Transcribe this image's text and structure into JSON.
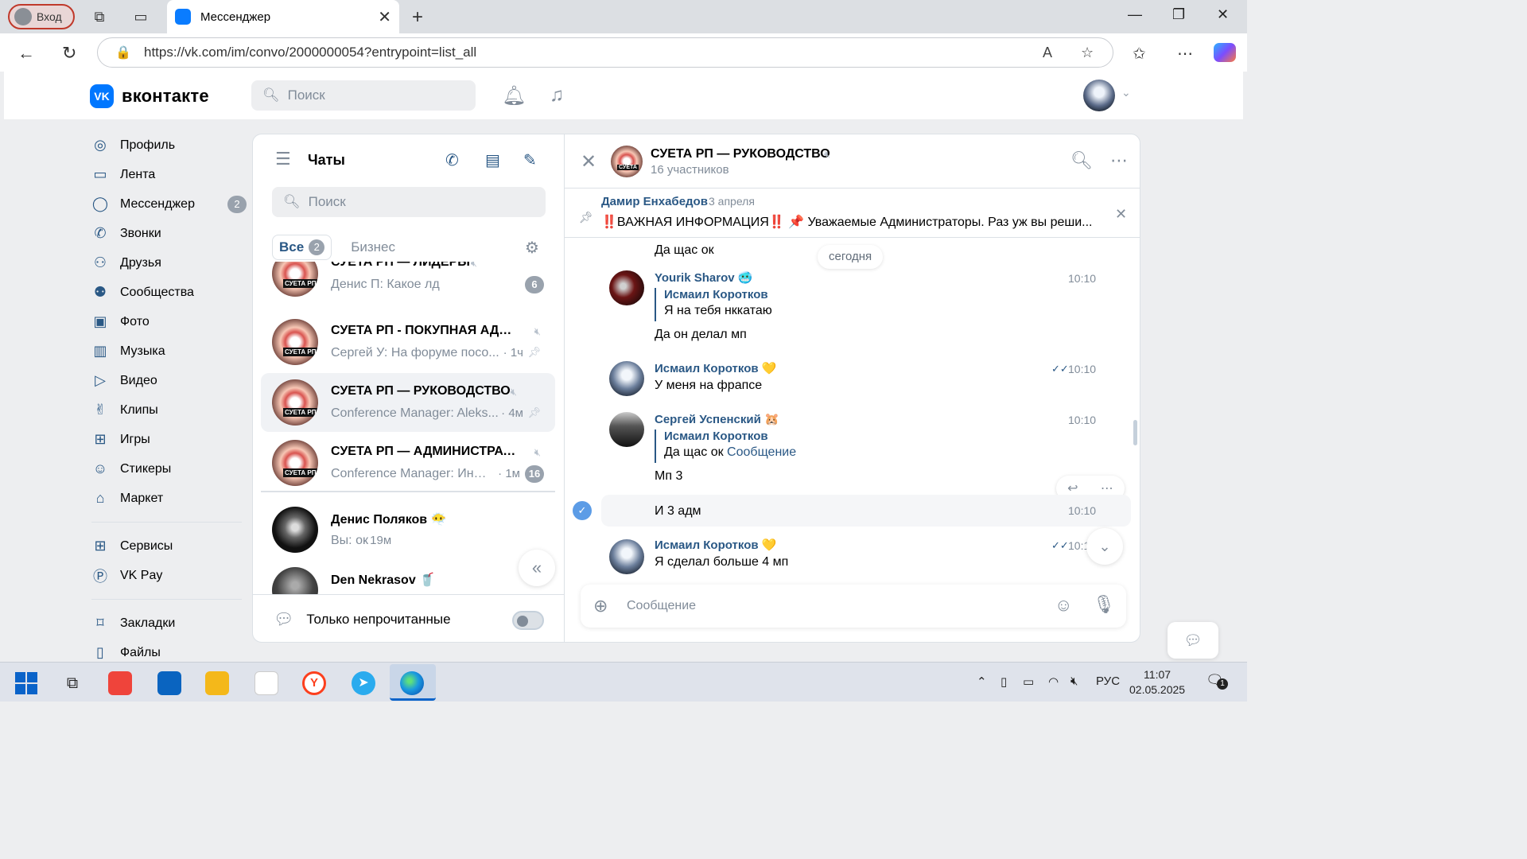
{
  "browser": {
    "profile_label": "Вход",
    "tab_title": "Мессенджер",
    "url": "https://vk.com/im/convo/2000000054?entrypoint=list_all"
  },
  "header": {
    "logo_text": "вконтакте",
    "search_placeholder": "Поиск"
  },
  "leftnav": {
    "items": [
      {
        "label": "Профиль",
        "icon": "profile-icon"
      },
      {
        "label": "Лента",
        "icon": "feed-icon"
      },
      {
        "label": "Мессенджер",
        "icon": "messenger-icon",
        "badge": "2"
      },
      {
        "label": "Звонки",
        "icon": "phone-icon"
      },
      {
        "label": "Друзья",
        "icon": "friends-icon"
      },
      {
        "label": "Сообщества",
        "icon": "communities-icon"
      },
      {
        "label": "Фото",
        "icon": "photo-icon"
      },
      {
        "label": "Музыка",
        "icon": "music-icon"
      },
      {
        "label": "Видео",
        "icon": "video-icon"
      },
      {
        "label": "Клипы",
        "icon": "clips-icon"
      },
      {
        "label": "Игры",
        "icon": "games-icon"
      },
      {
        "label": "Стикеры",
        "icon": "stickers-icon"
      },
      {
        "label": "Маркет",
        "icon": "market-icon"
      }
    ],
    "items2": [
      {
        "label": "Сервисы",
        "icon": "services-icon"
      },
      {
        "label": "VK Pay",
        "icon": "vkpay-icon"
      }
    ],
    "items3": [
      {
        "label": "Закладки",
        "icon": "bookmarks-icon"
      },
      {
        "label": "Файлы",
        "icon": "files-icon"
      }
    ]
  },
  "chatlist": {
    "title": "Чаты",
    "search_placeholder": "Поиск",
    "tab_all": "Все",
    "tab_all_count": "2",
    "tab_business": "Бизнес",
    "conversations": [
      {
        "name": "СУЕТА РП — ЛИДЕРЫ",
        "message": "Денис П: Какое лд",
        "time": "",
        "unread": "6",
        "muted": true,
        "pinned": false,
        "avatar_label": "СУЕТА РП"
      },
      {
        "name": "СУЕТА РП - ПОКУПНАЯ АДМИ...",
        "message": "Сергей У: На форуме посо...",
        "time": "· 1ч",
        "unread": "",
        "muted": true,
        "pinned": true,
        "avatar_label": "СУЕТА РП"
      },
      {
        "name": "СУЕТА РП — РУКОВОДСТВО",
        "message": "Conference Manager: Aleks...",
        "time": "· 4м",
        "unread": "",
        "muted": true,
        "pinned": true,
        "avatar_label": "СУЕТА РП"
      },
      {
        "name": "СУЕТА РП — АДМИНИСТРАТО...",
        "message": "Conference Manager: Инф...",
        "time": "· 1м",
        "unread": "16",
        "muted": true,
        "pinned": false,
        "avatar_label": "СУЕТА РП"
      },
      {
        "name": "Денис Поляков 😶‍🌫️",
        "message": "Вы: ок",
        "time": "· 19м",
        "unread": "",
        "muted": false,
        "pinned": false
      },
      {
        "name": "Den Nekrasov 🥤",
        "message": "",
        "time": "",
        "unread": "",
        "muted": false,
        "pinned": false
      }
    ],
    "footer_label": "Только непрочитанные"
  },
  "conversation": {
    "title": "СУЕТА РП — РУКОВОДСТВО",
    "avatar_label": "СУЕТА",
    "subtitle": "16 участников",
    "pinned": {
      "author": "Дамир Енхабедов",
      "date": "3 апреля",
      "text": "‼️ВАЖНАЯ ИНФОРМАЦИЯ‼️ 📌 Уважаемые Администраторы. Раз уж вы реши..."
    },
    "day_label": "сегодня",
    "messages": {
      "m0_text": "Да щас ок",
      "m1_name": "Yourik Sharov 🥶",
      "m1_time": "10:10",
      "m1_reply_name": "Исмаил Коротков",
      "m1_reply_text": "Я на тебя нккатаю",
      "m1_text": "Да он делал мп",
      "m2_name": "Исмаил Коротков 💛",
      "m2_time": "10:10",
      "m2_text": "У меня на фрапсе",
      "m3_name": "Сергей Успенский 🐹",
      "m3_time": "10:10",
      "m3_reply_name": "Исмаил Коротков",
      "m3_reply_text": "Да щас ок",
      "m3_reply_link": "Сообщение",
      "m3_text": "Мп 3",
      "m4_text": "И 3 адм",
      "m4_time": "10:10",
      "m5_name": "Исмаил Коротков 💛",
      "m5_time": "10:1",
      "m5_text": "Я сделал больше 4 мп"
    },
    "composer_placeholder": "Сообщение"
  },
  "taskbar": {
    "lang": "РУС",
    "time": "11:07",
    "date": "02.05.2025",
    "notif_count": "1"
  },
  "colors": {
    "vk_blue": "#0077ff",
    "link": "#2a5885",
    "muted_text": "#818c99",
    "badge": "#99a2ad"
  }
}
